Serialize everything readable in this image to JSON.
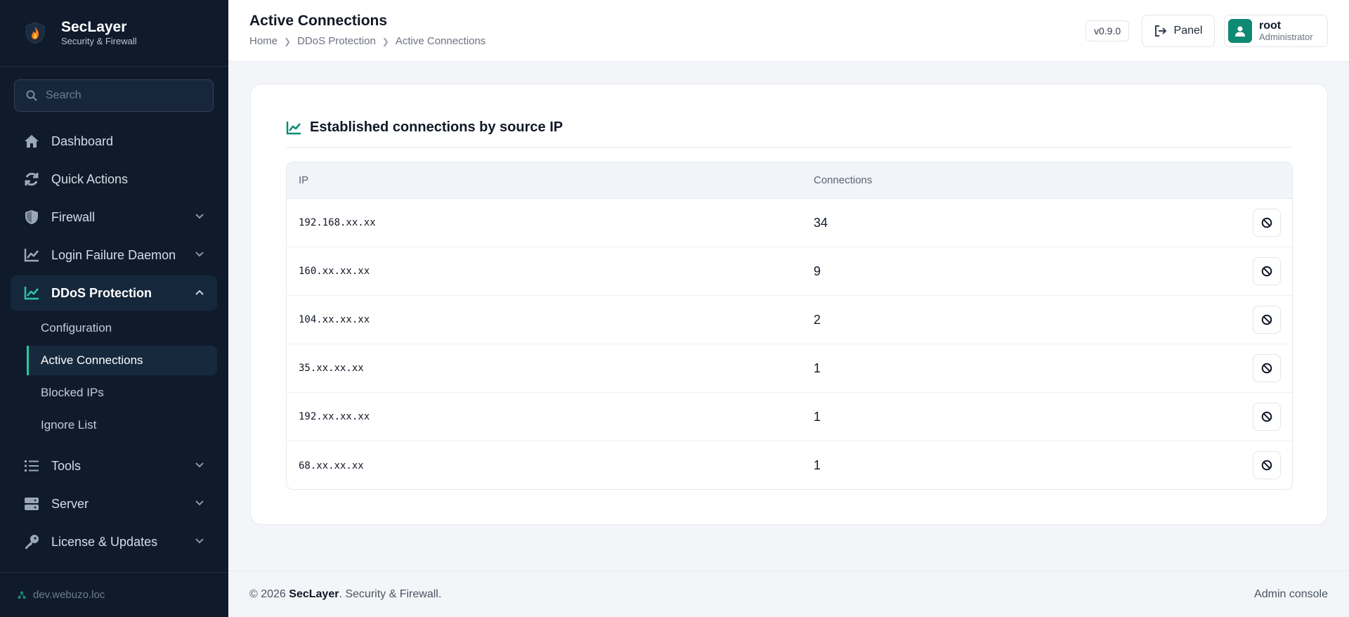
{
  "brand": {
    "name": "SecLayer",
    "tagline": "Security & Firewall"
  },
  "search": {
    "placeholder": "Search"
  },
  "sidebar": {
    "items": [
      {
        "label": "Dashboard",
        "icon": "home-icon"
      },
      {
        "label": "Quick Actions",
        "icon": "refresh-icon"
      },
      {
        "label": "Firewall",
        "icon": "shield-icon"
      },
      {
        "label": "Login Failure Daemon",
        "icon": "chart-line-icon"
      },
      {
        "label": "DDoS Protection",
        "icon": "chart-line-icon"
      },
      {
        "label": "Tools",
        "icon": "list-icon"
      },
      {
        "label": "Server",
        "icon": "server-icon"
      },
      {
        "label": "License & Updates",
        "icon": "key-icon"
      }
    ],
    "ddos_sub": [
      "Configuration",
      "Active Connections",
      "Blocked IPs",
      "Ignore List"
    ],
    "host": "dev.webuzo.loc"
  },
  "header": {
    "title": "Active Connections",
    "breadcrumb": [
      "Home",
      "DDoS Protection",
      "Active Connections"
    ],
    "version": "v0.9.0",
    "panel_label": "Panel",
    "user": {
      "name": "root",
      "role": "Administrator"
    }
  },
  "card": {
    "title": "Established connections by source IP",
    "columns": [
      "IP",
      "Connections"
    ],
    "rows": [
      {
        "ip": "192.168.xx.xx",
        "connections": "34"
      },
      {
        "ip": "160.xx.xx.xx",
        "connections": "9"
      },
      {
        "ip": "104.xx.xx.xx",
        "connections": "2"
      },
      {
        "ip": "35.xx.xx.xx",
        "connections": "1"
      },
      {
        "ip": "192.xx.xx.xx",
        "connections": "1"
      },
      {
        "ip": "68.xx.xx.xx",
        "connections": "1"
      }
    ]
  },
  "footer": {
    "copyright_prefix": "© 2026 ",
    "brand": "SecLayer",
    "copyright_suffix": ". Security & Firewall.",
    "right": "Admin console"
  },
  "colors": {
    "sidebar_bg": "#0f1b2b",
    "accent": "#2cc7a5",
    "avatar": "#0e8a72"
  }
}
